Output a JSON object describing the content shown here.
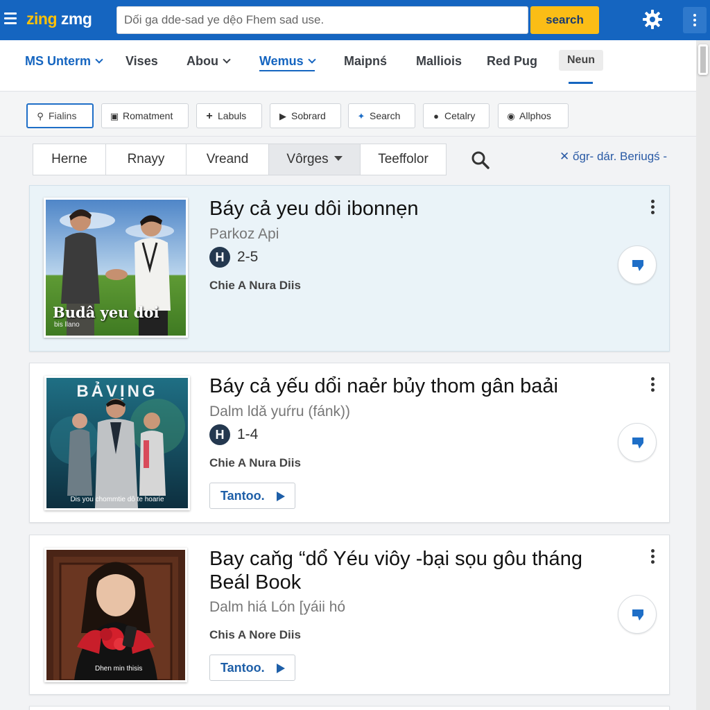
{
  "header": {
    "logo_part1": "zing",
    "logo_part2": "zmg",
    "search_value": "Dối ga dde-sad ye dệo Fhem sad use.",
    "search_button": "search"
  },
  "nav": {
    "items": [
      "MS Unterm",
      "Vises",
      "Abou",
      "Wemus",
      "Maipnś",
      "Malliois",
      "Red Pug",
      "Neun"
    ]
  },
  "filters": {
    "buttons": [
      "Fialins",
      "Romatment",
      "Labuls",
      "Sobrard",
      "Search",
      "Cetalry",
      "Allphos"
    ]
  },
  "tabs": {
    "items": [
      "Herne",
      "Rnayy",
      "Vreand",
      "Vôrges",
      "Teeffolor"
    ],
    "clear_label": "ốgr- dár. Beriugś -"
  },
  "results": [
    {
      "title": "Báy cả yeu dôi ibonnẹn",
      "subtitle": "Parkoz Api",
      "rating_badge": "H",
      "rating_value": "2-5",
      "author": "Chie A Nura Diis",
      "thumb_caption": "Budâ yeu doi",
      "thumb_subcaption": "bis llano"
    },
    {
      "title": "Báy cả yếu dổi naẻr bủy thom gân baải",
      "subtitle": "Dalm ldǎ yuŕru (fánk))",
      "rating_badge": "H",
      "rating_value": "1-4",
      "author": "Chie A Nura Diis",
      "play_label": "Tantoo.",
      "thumb_caption": "BẢVỊNG",
      "thumb_subcaption": "Dis you chommtie dô te hoarie"
    },
    {
      "title": "Bay caňg “dổ  Yéu viôy -bại sọu gôu  tháng",
      "title2": "Beál Book",
      "subtitle": "Dalm hiá Lón [yáii hó",
      "author": "Chis A Nore Diis",
      "play_label": "Tantoo.",
      "thumb_caption": "Dhen min thisis"
    }
  ],
  "colors": {
    "header_bg": "#1565c0",
    "logo_accent": "#ffc107",
    "search_button_bg": "#fbbd16",
    "link_blue": "#1565c0",
    "highlight_card_bg": "#eaf3f8"
  }
}
